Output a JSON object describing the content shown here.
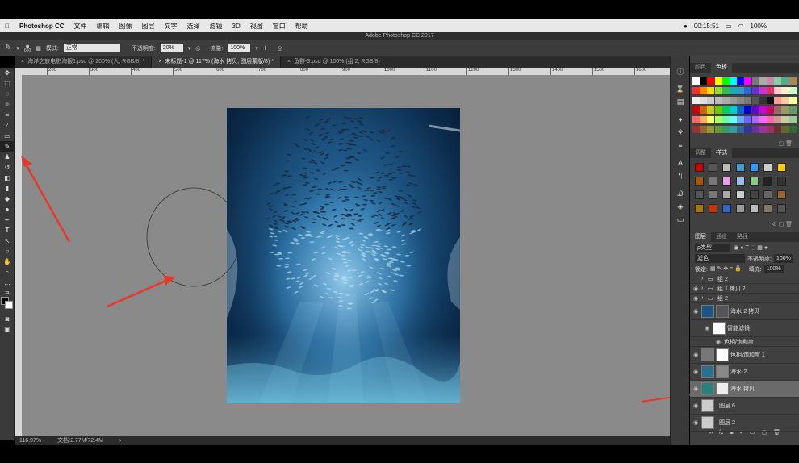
{
  "menubar": {
    "app": "Photoshop CC",
    "items": [
      "文件",
      "编辑",
      "图像",
      "图层",
      "文字",
      "选择",
      "滤镜",
      "3D",
      "视图",
      "窗口",
      "帮助"
    ],
    "timer": "00:15:51",
    "status_right": "100%"
  },
  "window_title": "Adobe Photoshop CC 2017",
  "options": {
    "brush_size": "600",
    "mode_label": "模式:",
    "mode_value": "正常",
    "opacity_label": "不透明度:",
    "opacity_value": "20%",
    "flow_label": "流量:",
    "flow_value": "100%"
  },
  "tabs": [
    {
      "label": "海洋之旅电影海报1.psd @ 200% (人, RGB/8) *"
    },
    {
      "label": "未标题-1 @ 117% (海水 拷贝, 图层蒙版/8) *"
    },
    {
      "label": "鱼群-3.psd @ 100% (组 2, RGB/8)"
    }
  ],
  "ruler_ticks": [
    "200",
    "300",
    "400",
    "500",
    "600",
    "700",
    "800",
    "900",
    "1000",
    "1100",
    "1200",
    "1300",
    "1400",
    "1500",
    "1600"
  ],
  "status": {
    "zoom": "116.97%",
    "doc": "文档:2.77M/72.4M"
  },
  "panels": {
    "swatches_tabs": [
      "颜色",
      "色板"
    ],
    "adjust_tabs": [
      "调整",
      "样式"
    ],
    "layers_tabs": [
      "图层",
      "通道",
      "路径"
    ],
    "kind_label": "ρ类型",
    "blend_mode": "滤色",
    "opacity_label": "不透明度:",
    "opacity_value": "100%",
    "lock_label": "锁定:",
    "fill_label": "填充:",
    "fill_value": "100%"
  },
  "layers": [
    {
      "name": "组 2"
    },
    {
      "name": "组 1 拷贝 2"
    },
    {
      "name": "组 2"
    },
    {
      "name": "海水-2 拷贝"
    },
    {
      "name": "智能滤镜"
    },
    {
      "name": "色相/饱和度"
    },
    {
      "name": "色相/饱和度 1"
    },
    {
      "name": "海水-2"
    },
    {
      "name": "海水 拷贝"
    },
    {
      "name": "图层 6"
    },
    {
      "name": "图层 2"
    }
  ],
  "colors": {
    "arrow": "#e8382b",
    "accent": "#1d5584"
  }
}
